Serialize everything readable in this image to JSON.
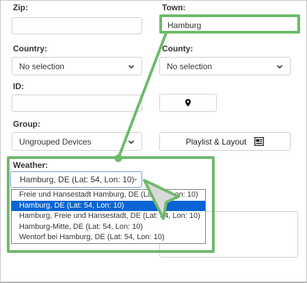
{
  "form": {
    "zip": {
      "label": "Zip:",
      "value": ""
    },
    "town": {
      "label": "Town:",
      "value": "Hamburg"
    },
    "country": {
      "label": "Country:",
      "selected": "No selection"
    },
    "county": {
      "label": "County:",
      "selected": "No selection"
    },
    "id": {
      "label": "ID:",
      "value": ""
    },
    "group": {
      "label": "Group:",
      "selected": "Ungrouped Devices"
    },
    "playlist_button": {
      "label": "Playlist & Layout"
    },
    "weather": {
      "label": "Weather:",
      "selected": "Hamburg, DE (Lat: 54, Lon: 10)",
      "options": [
        "Freie und Hansestadt Hamburg, DE (Lat: 54, Lon: 10)",
        "Hamburg, DE (Lat: 54, Lon: 10)",
        "Hamburg, Freie und Hansestadt, DE (Lat: 54, Lon: 10)",
        "Hamburg-Mitte, DE (Lat: 54, Lon: 10)",
        "Wentorf bei Hamburg, DE (Lat: 54, Lon: 10)"
      ],
      "selected_index": 1
    }
  },
  "icons": {
    "location": "map-marker-icon",
    "layout": "layout-preview-icon",
    "select_arrow": "chevron-down-icon"
  },
  "colors": {
    "highlight": "#6dba6a",
    "selected_option": "#0a64d3"
  }
}
